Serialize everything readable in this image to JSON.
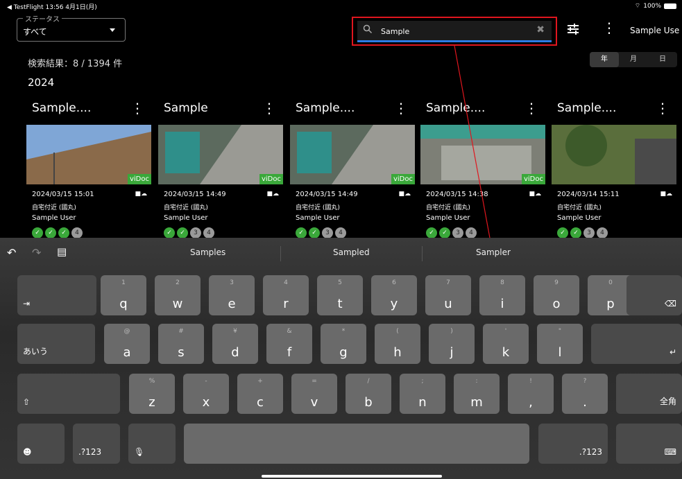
{
  "status_bar": {
    "left": "◀ TestFlight  13:56  4月1日(月)",
    "right": "100%"
  },
  "filter": {
    "legend": "ステータス",
    "value": "すべて"
  },
  "search": {
    "value": "Sample"
  },
  "header": {
    "username": "Sample Use"
  },
  "results": {
    "count": "検索結果：8 / 1394 件",
    "year": "2024"
  },
  "period_tabs": [
    "年",
    "月",
    "日"
  ],
  "cards": [
    {
      "title": "Sample....",
      "date": "2024/03/15  15:01",
      "location": "自宅付近 (國丸)",
      "user": "Sample User",
      "badge": "viDoc",
      "steps": [
        "✓",
        "✓",
        "✓",
        "4"
      ]
    },
    {
      "title": "Sample",
      "date": "2024/03/15  14:49",
      "location": "自宅付近 (國丸)",
      "user": "Sample User",
      "badge": "viDoc",
      "steps": [
        "✓",
        "✓",
        "3",
        "4"
      ]
    },
    {
      "title": "Sample....",
      "date": "2024/03/15  14:49",
      "location": "自宅付近 (國丸)",
      "user": "Sample User",
      "badge": "viDoc",
      "steps": [
        "✓",
        "✓",
        "3",
        "4"
      ]
    },
    {
      "title": "Sample....",
      "date": "2024/03/15  14:38",
      "location": "自宅付近 (國丸)",
      "user": "Sample User",
      "badge": "viDoc",
      "steps": [
        "✓",
        "✓",
        "3",
        "4"
      ]
    },
    {
      "title": "Sample....",
      "date": "2024/03/14  15:11",
      "location": "自宅付近 (國丸)",
      "user": "Sample User",
      "badge": "",
      "steps": [
        "✓",
        "✓",
        "3",
        "4"
      ]
    }
  ],
  "suggestions": [
    "Samples",
    "Sampled",
    "Sampler"
  ],
  "keyboard": {
    "row1": [
      {
        "h": "1",
        "k": "q"
      },
      {
        "h": "2",
        "k": "w"
      },
      {
        "h": "3",
        "k": "e"
      },
      {
        "h": "4",
        "k": "r"
      },
      {
        "h": "5",
        "k": "t"
      },
      {
        "h": "6",
        "k": "y"
      },
      {
        "h": "7",
        "k": "u"
      },
      {
        "h": "8",
        "k": "i"
      },
      {
        "h": "9",
        "k": "o"
      },
      {
        "h": "0",
        "k": "p"
      }
    ],
    "row2": [
      {
        "h": "@",
        "k": "a"
      },
      {
        "h": "#",
        "k": "s"
      },
      {
        "h": "¥",
        "k": "d"
      },
      {
        "h": "&",
        "k": "f"
      },
      {
        "h": "*",
        "k": "g"
      },
      {
        "h": "(",
        "k": "h"
      },
      {
        "h": ")",
        "k": "j"
      },
      {
        "h": "'",
        "k": "k"
      },
      {
        "h": "\"",
        "k": "l"
      }
    ],
    "row3": [
      {
        "h": "%",
        "k": "z"
      },
      {
        "h": "-",
        "k": "x"
      },
      {
        "h": "+",
        "k": "c"
      },
      {
        "h": "=",
        "k": "v"
      },
      {
        "h": "/",
        "k": "b"
      },
      {
        "h": ";",
        "k": "n"
      },
      {
        "h": ":",
        "k": "m"
      },
      {
        "h": "!",
        "k": ","
      },
      {
        "h": "?",
        "k": "."
      }
    ],
    "kana_label": "あいう",
    "zenkaku_label": "全角",
    "numbers_label": ".?123"
  }
}
